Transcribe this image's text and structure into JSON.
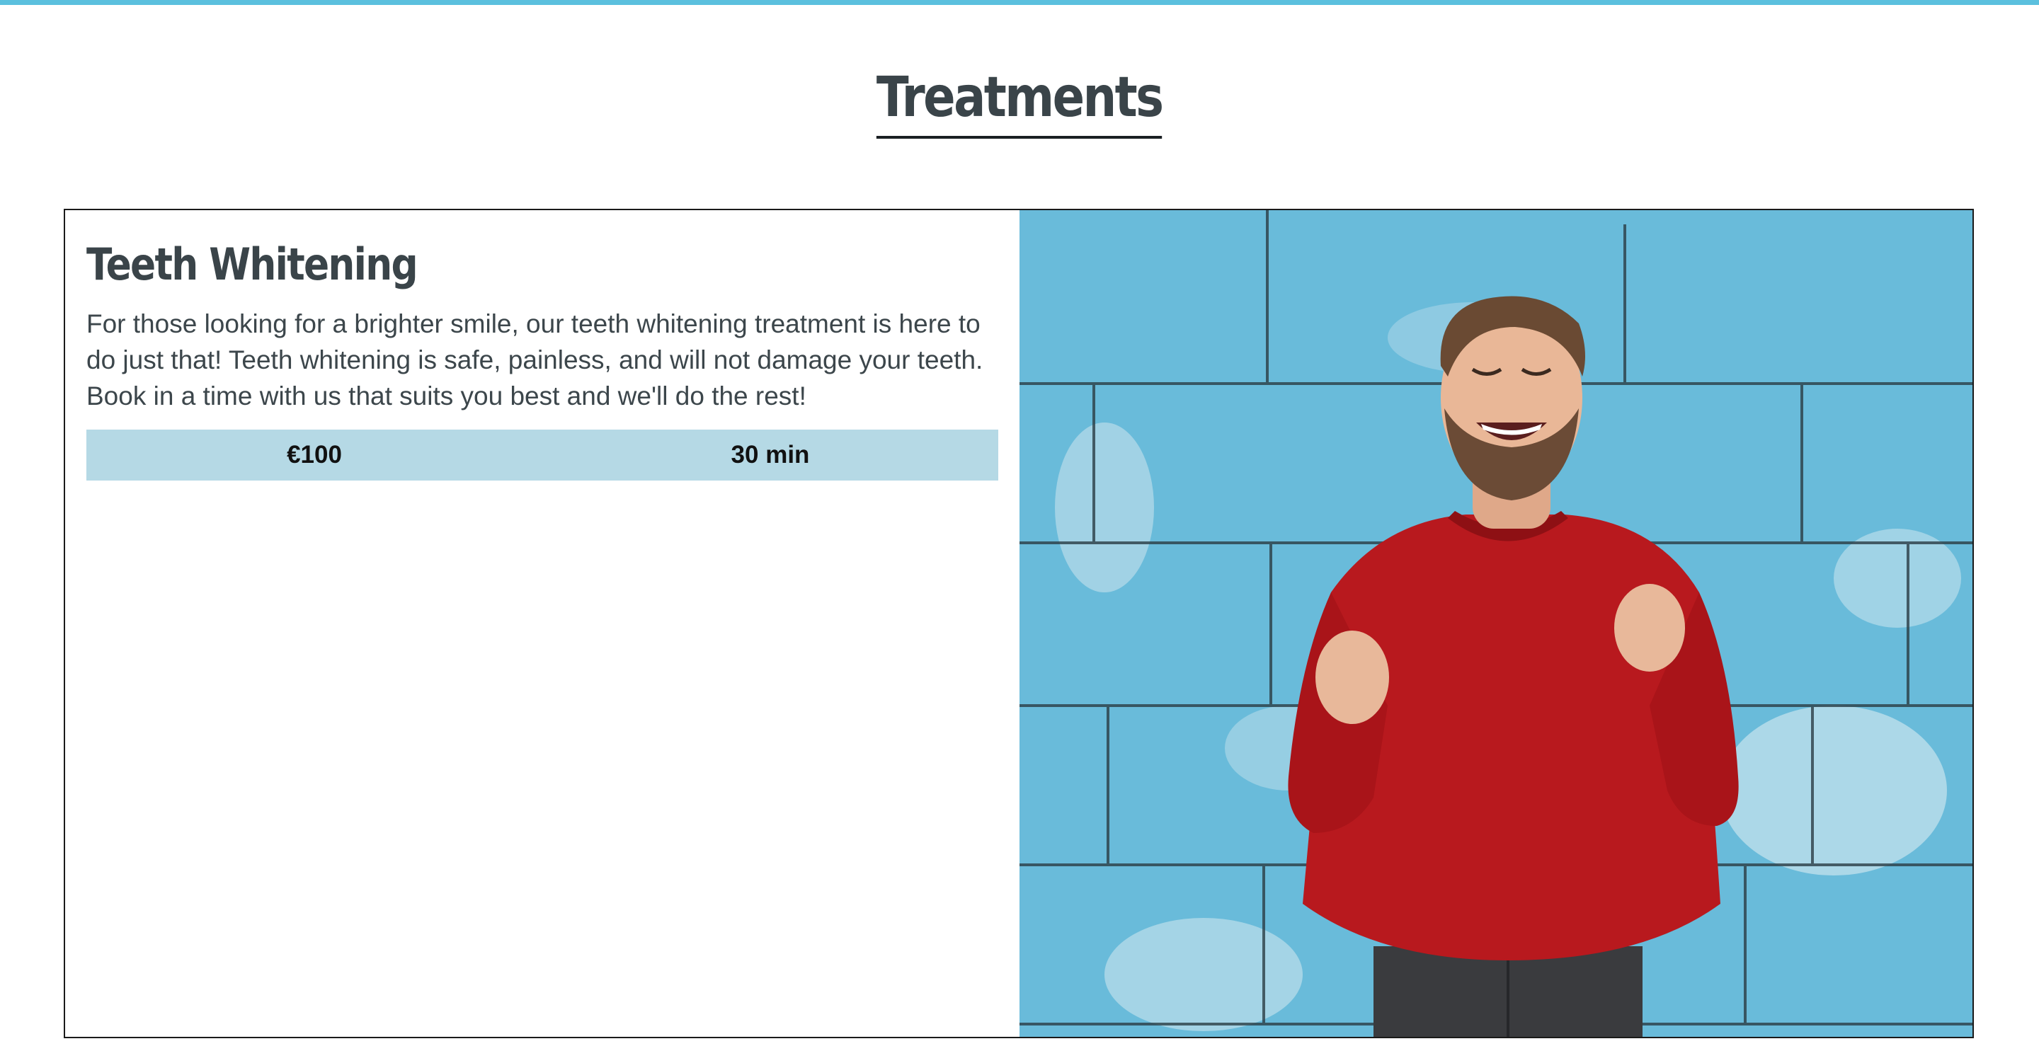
{
  "page": {
    "title": "Treatments",
    "accent_color": "#5bc0de"
  },
  "treatment": {
    "title": "Teeth Whitening",
    "description": "For those looking for a brighter smile, our teeth whitening treatment is here to do just that! Teeth whitening is safe, painless, and will not damage your teeth. Book in a time with us that suits you best and we'll do the rest!",
    "price": "€100",
    "duration": "30 min",
    "meta_bg_color": "#b5d9e5",
    "image_icon": "photo-man-celebrating-icon"
  }
}
